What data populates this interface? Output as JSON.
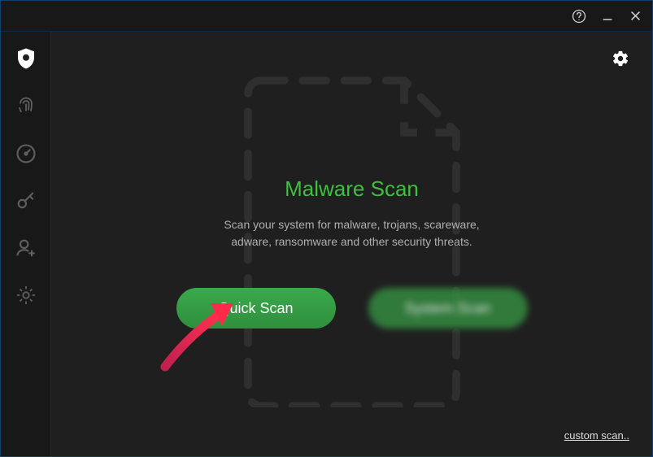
{
  "titlebar": {
    "help": "Help",
    "minimize": "Minimize",
    "close": "Close"
  },
  "sidebar": {
    "items": [
      {
        "name": "shield-icon"
      },
      {
        "name": "fingerprint-icon"
      },
      {
        "name": "speedometer-icon"
      },
      {
        "name": "key-icon"
      },
      {
        "name": "user-add-icon"
      },
      {
        "name": "gear-icon"
      }
    ]
  },
  "main": {
    "title": "Malware Scan",
    "subtitle_line1": "Scan your system for malware, trojans, scareware,",
    "subtitle_line2": "adware, ransomware and other security threats.",
    "quick_scan_label": "Quick Scan",
    "system_scan_label": "System Scan",
    "custom_scan_label": "custom scan.."
  },
  "colors": {
    "accent": "#3fbf3f",
    "button_primary": "#3aa94a"
  }
}
